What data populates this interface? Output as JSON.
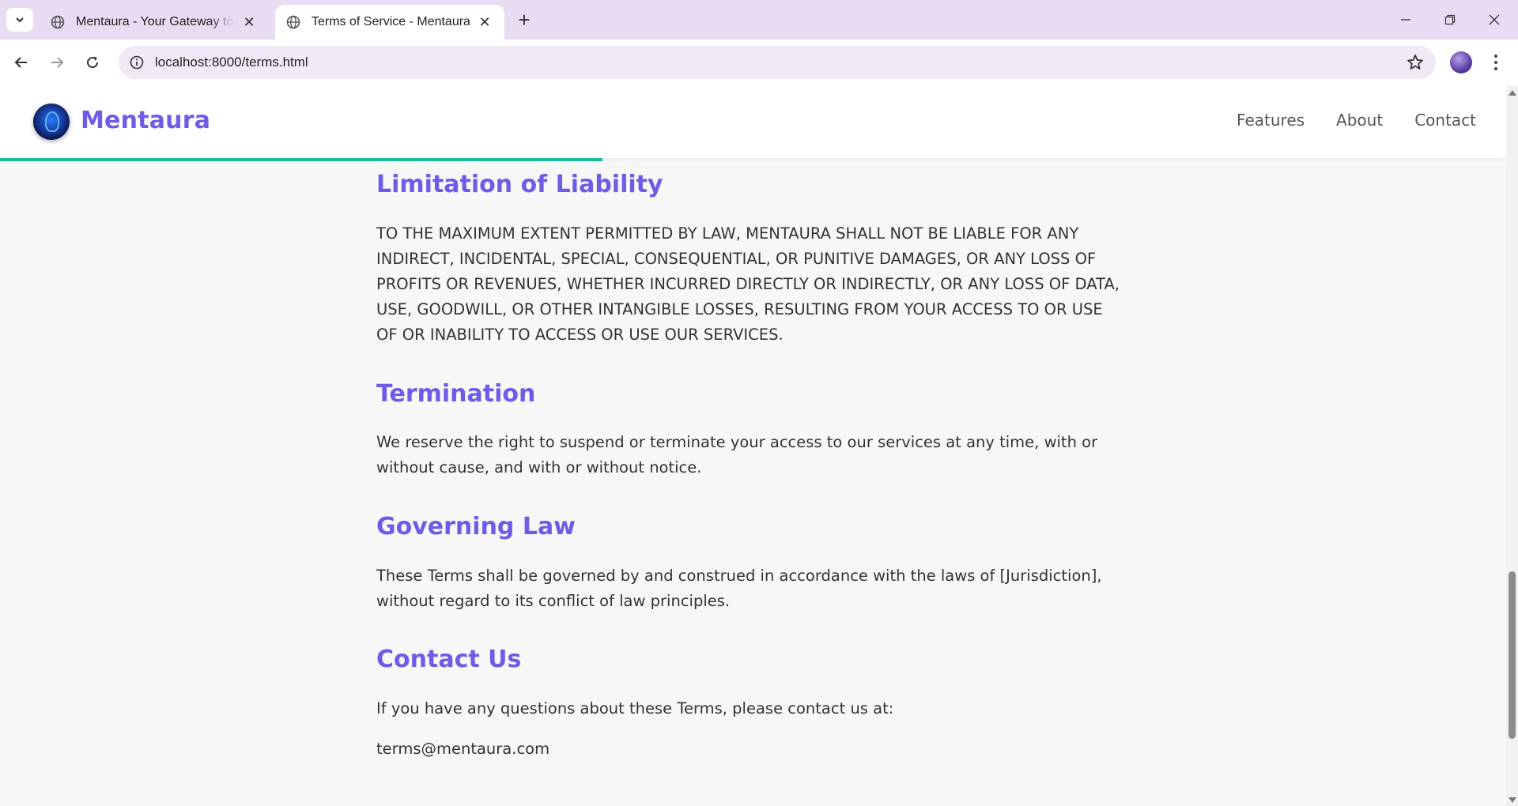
{
  "browser": {
    "tabs": [
      {
        "title": "Mentaura - Your Gateway to Le",
        "active": false
      },
      {
        "title": "Terms of Service - Mentaura",
        "active": true
      }
    ],
    "new_tab_symbol": "+",
    "close_symbol": "✕",
    "url": "localhost:8000/terms.html",
    "icons": [
      "tab-search-icon",
      "globe-icon",
      "close-icon",
      "new-tab-icon",
      "minimize-icon",
      "restore-icon",
      "window-close-icon",
      "back-icon",
      "forward-icon",
      "reload-icon",
      "site-info-icon",
      "bookmark-star-icon",
      "profile-avatar",
      "more-menu-icon"
    ]
  },
  "site": {
    "brand": "Mentaura",
    "nav": [
      "Features",
      "About",
      "Contact"
    ],
    "accent_color": "#6c5ce7",
    "progress_color": "#1abc9c",
    "reading_progress_fraction": 0.4
  },
  "sections": [
    {
      "heading": "Limitation of Liability",
      "paragraphs": [
        "TO THE MAXIMUM EXTENT PERMITTED BY LAW, MENTAURA SHALL NOT BE LIABLE FOR ANY INDIRECT, INCIDENTAL, SPECIAL, CONSEQUENTIAL, OR PUNITIVE DAMAGES, OR ANY LOSS OF PROFITS OR REVENUES, WHETHER INCURRED DIRECTLY OR INDIRECTLY, OR ANY LOSS OF DATA, USE, GOODWILL, OR OTHER INTANGIBLE LOSSES, RESULTING FROM YOUR ACCESS TO OR USE OF OR INABILITY TO ACCESS OR USE OUR SERVICES."
      ]
    },
    {
      "heading": "Termination",
      "paragraphs": [
        "We reserve the right to suspend or terminate your access to our services at any time, with or without cause, and with or without notice."
      ]
    },
    {
      "heading": "Governing Law",
      "paragraphs": [
        "These Terms shall be governed by and construed in accordance with the laws of [Jurisdiction], without regard to its conflict of law principles."
      ]
    },
    {
      "heading": "Contact Us",
      "paragraphs": [
        "If you have any questions about these Terms, please contact us at:",
        "terms@mentaura.com"
      ]
    }
  ]
}
